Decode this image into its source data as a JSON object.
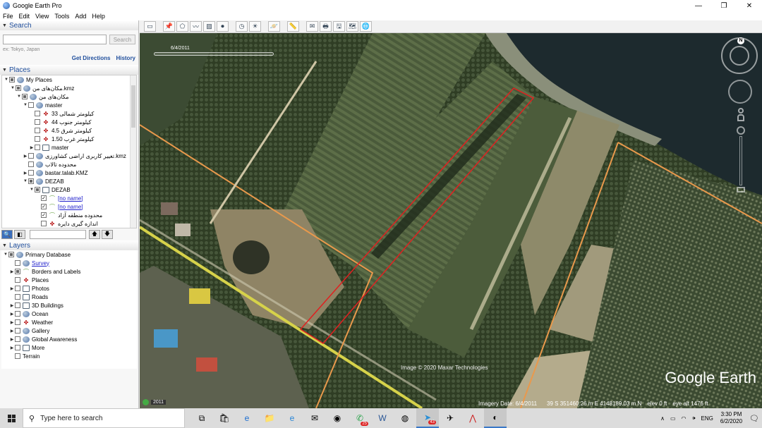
{
  "window": {
    "title": "Google Earth Pro",
    "min": "—",
    "restore": "❐",
    "close": "✕"
  },
  "menu": [
    "File",
    "Edit",
    "View",
    "Tools",
    "Add",
    "Help"
  ],
  "search": {
    "header": "Search",
    "placeholder": "",
    "button": "Search",
    "hint": "ex: Tokyo, Japan",
    "get_directions": "Get Directions",
    "history": "History"
  },
  "places": {
    "header": "Places",
    "rows": [
      {
        "indent": 0,
        "exp": "▼",
        "cb": "part",
        "icon": "globe",
        "label": "My Places"
      },
      {
        "indent": 1,
        "exp": "▼",
        "cb": "part",
        "icon": "globe",
        "label": "مکان‌های من.kmz"
      },
      {
        "indent": 2,
        "exp": "▼",
        "cb": "part",
        "icon": "globe",
        "label": "مکان‌های من"
      },
      {
        "indent": 3,
        "exp": "▼",
        "cb": "empty",
        "icon": "globe",
        "label": "master"
      },
      {
        "indent": 4,
        "exp": "",
        "cb": "empty",
        "icon": "pin",
        "label": "کیلومتر شمالی 33"
      },
      {
        "indent": 4,
        "exp": "",
        "cb": "empty",
        "icon": "pin",
        "label": "کیلومتر جنوب 44"
      },
      {
        "indent": 4,
        "exp": "",
        "cb": "empty",
        "icon": "pin",
        "label": "کیلومتر شرق 4.5"
      },
      {
        "indent": 4,
        "exp": "",
        "cb": "empty",
        "icon": "pin",
        "label": "کیلومتر غرب 1.50"
      },
      {
        "indent": 4,
        "exp": "▶",
        "cb": "empty",
        "icon": "folder",
        "label": "master"
      },
      {
        "indent": 3,
        "exp": "▶",
        "cb": "empty",
        "icon": "globe",
        "label": "تغییر کاربری اراضی کشاورزی.kmz"
      },
      {
        "indent": 3,
        "exp": "",
        "cb": "empty",
        "icon": "globe",
        "label": "محدوده تالاب"
      },
      {
        "indent": 3,
        "exp": "▶",
        "cb": "empty",
        "icon": "globe",
        "label": "bastar.talab.KMZ"
      },
      {
        "indent": 3,
        "exp": "▼",
        "cb": "part",
        "icon": "globe",
        "label": "DEZAB"
      },
      {
        "indent": 4,
        "exp": "▼",
        "cb": "part",
        "icon": "folder",
        "label": "DEZAB"
      },
      {
        "indent": 5,
        "exp": "",
        "cb": "check",
        "icon": "path",
        "label": "[no name]",
        "link": true
      },
      {
        "indent": 5,
        "exp": "",
        "cb": "check",
        "icon": "path",
        "label": "[no name]",
        "link": true
      },
      {
        "indent": 5,
        "exp": "",
        "cb": "check",
        "icon": "path",
        "label": "محدوده منطقه آزاد"
      },
      {
        "indent": 5,
        "exp": "",
        "cb": "empty",
        "icon": "pin",
        "label": "اندازه گیری دایره"
      }
    ]
  },
  "places_tools": {
    "up": "🡅",
    "down": "🡇"
  },
  "layers": {
    "header": "Layers",
    "rows": [
      {
        "exp": "▼",
        "cb": "part",
        "icon": "globe",
        "label": "Primary Database",
        "indent": 0
      },
      {
        "exp": "",
        "cb": "empty",
        "icon": "globe",
        "label": "Survey",
        "indent": 1,
        "link": true
      },
      {
        "exp": "▶",
        "cb": "part",
        "icon": "path",
        "label": "Borders and Labels",
        "indent": 1
      },
      {
        "exp": "",
        "cb": "empty",
        "icon": "pin",
        "label": "Places",
        "indent": 1
      },
      {
        "exp": "▶",
        "cb": "empty",
        "icon": "folder",
        "label": "Photos",
        "indent": 1
      },
      {
        "exp": "",
        "cb": "empty",
        "icon": "folder",
        "label": "Roads",
        "indent": 1
      },
      {
        "exp": "▶",
        "cb": "empty",
        "icon": "folder",
        "label": "3D Buildings",
        "indent": 1
      },
      {
        "exp": "▶",
        "cb": "empty",
        "icon": "globe",
        "label": "Ocean",
        "indent": 1
      },
      {
        "exp": "▶",
        "cb": "empty",
        "icon": "pin",
        "label": "Weather",
        "indent": 1
      },
      {
        "exp": "▶",
        "cb": "empty",
        "icon": "globe",
        "label": "Gallery",
        "indent": 1
      },
      {
        "exp": "▶",
        "cb": "empty",
        "icon": "globe",
        "label": "Global Awareness",
        "indent": 1
      },
      {
        "exp": "▶",
        "cb": "empty",
        "icon": "folder",
        "label": "More",
        "indent": 1
      },
      {
        "exp": "",
        "cb": "empty",
        "icon": "none",
        "label": "Terrain",
        "indent": 1
      }
    ]
  },
  "map": {
    "date_slider": "6/4/2011",
    "year_badge": "2011",
    "copyright": "Image © 2020 Maxar Technologies",
    "brand": "Google Earth",
    "north": "N",
    "status": {
      "imagery_date": "Imagery Date: 6/4/2011",
      "coords": "39 S 351460.26 m E 4148189.03 m N",
      "elev": "elev   0 ft",
      "eye_alt": "eye alt  1476 ft"
    }
  },
  "taskbar": {
    "search_text": "Type here to search",
    "lang": "ENG",
    "time": "3:30 PM",
    "date": "6/2/2020",
    "badges": {
      "whatsapp": "25",
      "telegram": "43"
    }
  }
}
